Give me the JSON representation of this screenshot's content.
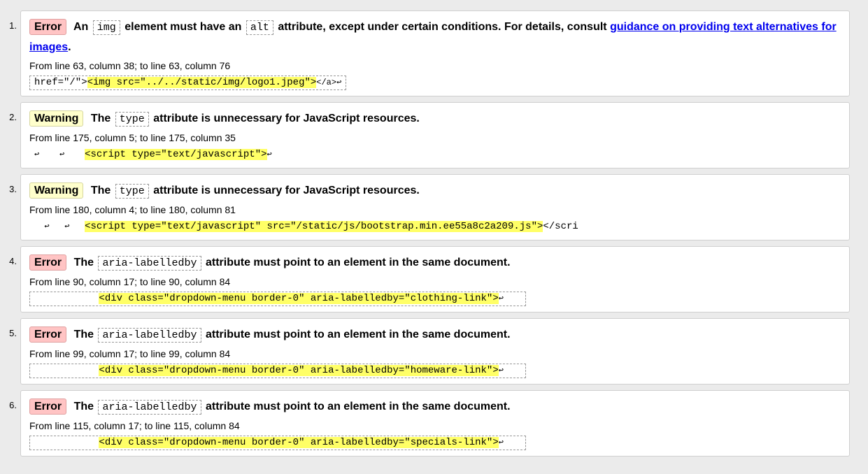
{
  "messages": [
    {
      "num": "1.",
      "type": "Error",
      "text_before": "An",
      "code1": "img",
      "text_mid": "element must have an",
      "code2": "alt",
      "text_after": "attribute, except under certain conditions. For details, consult",
      "link": "guidance on providing text alternatives for images",
      "link_end": ".",
      "location": "From line 63, column 38; to line 63, column 76",
      "extract_pre": "href=\"/\">",
      "extract_hl": "<img src=\"../../static/img/logo1.jpeg\">",
      "extract_post": "</a>↩"
    },
    {
      "num": "2.",
      "type": "Warning",
      "text_before": "The",
      "code1": "type",
      "text_after": "attribute is unnecessary for JavaScript resources.",
      "location": "From line 175, column 5; to line 175, column 35",
      "extract_pre": "↩    ↩    ",
      "extract_hl": "<script type=\"text/javascript\">",
      "extract_post": "↩"
    },
    {
      "num": "3.",
      "type": "Warning",
      "text_before": "The",
      "code1": "type",
      "text_after": "attribute is unnecessary for JavaScript resources.",
      "location": "From line 180, column 4; to line 180, column 81",
      "extract_pre": "  ↩   ↩   ",
      "extract_hl": "<script type=\"text/javascript\" src=\"/static/js/bootstrap.min.ee55a8c2a209.js\">",
      "extract_post": "</scri"
    },
    {
      "num": "4.",
      "type": "Error",
      "text_before": "The",
      "code1": "aria-labelledby",
      "text_after": "attribute must point to an element in the same document.",
      "location": "From line 90, column 17; to line 90, column 84",
      "extract_pre": "           ",
      "extract_hl": "<div class=\"dropdown-menu border-0\" aria-labelledby=\"clothing-link\">",
      "extract_post": "↩"
    },
    {
      "num": "5.",
      "type": "Error",
      "text_before": "The",
      "code1": "aria-labelledby",
      "text_after": "attribute must point to an element in the same document.",
      "location": "From line 99, column 17; to line 99, column 84",
      "extract_pre": "           ",
      "extract_hl": "<div class=\"dropdown-menu border-0\" aria-labelledby=\"homeware-link\">",
      "extract_post": "↩"
    },
    {
      "num": "6.",
      "type": "Error",
      "text_before": "The",
      "code1": "aria-labelledby",
      "text_after": "attribute must point to an element in the same document.",
      "location": "From line 115, column 17; to line 115, column 84",
      "extract_pre": "           ",
      "extract_hl": "<div class=\"dropdown-menu border-0\" aria-labelledby=\"specials-link\">",
      "extract_post": "↩"
    }
  ]
}
